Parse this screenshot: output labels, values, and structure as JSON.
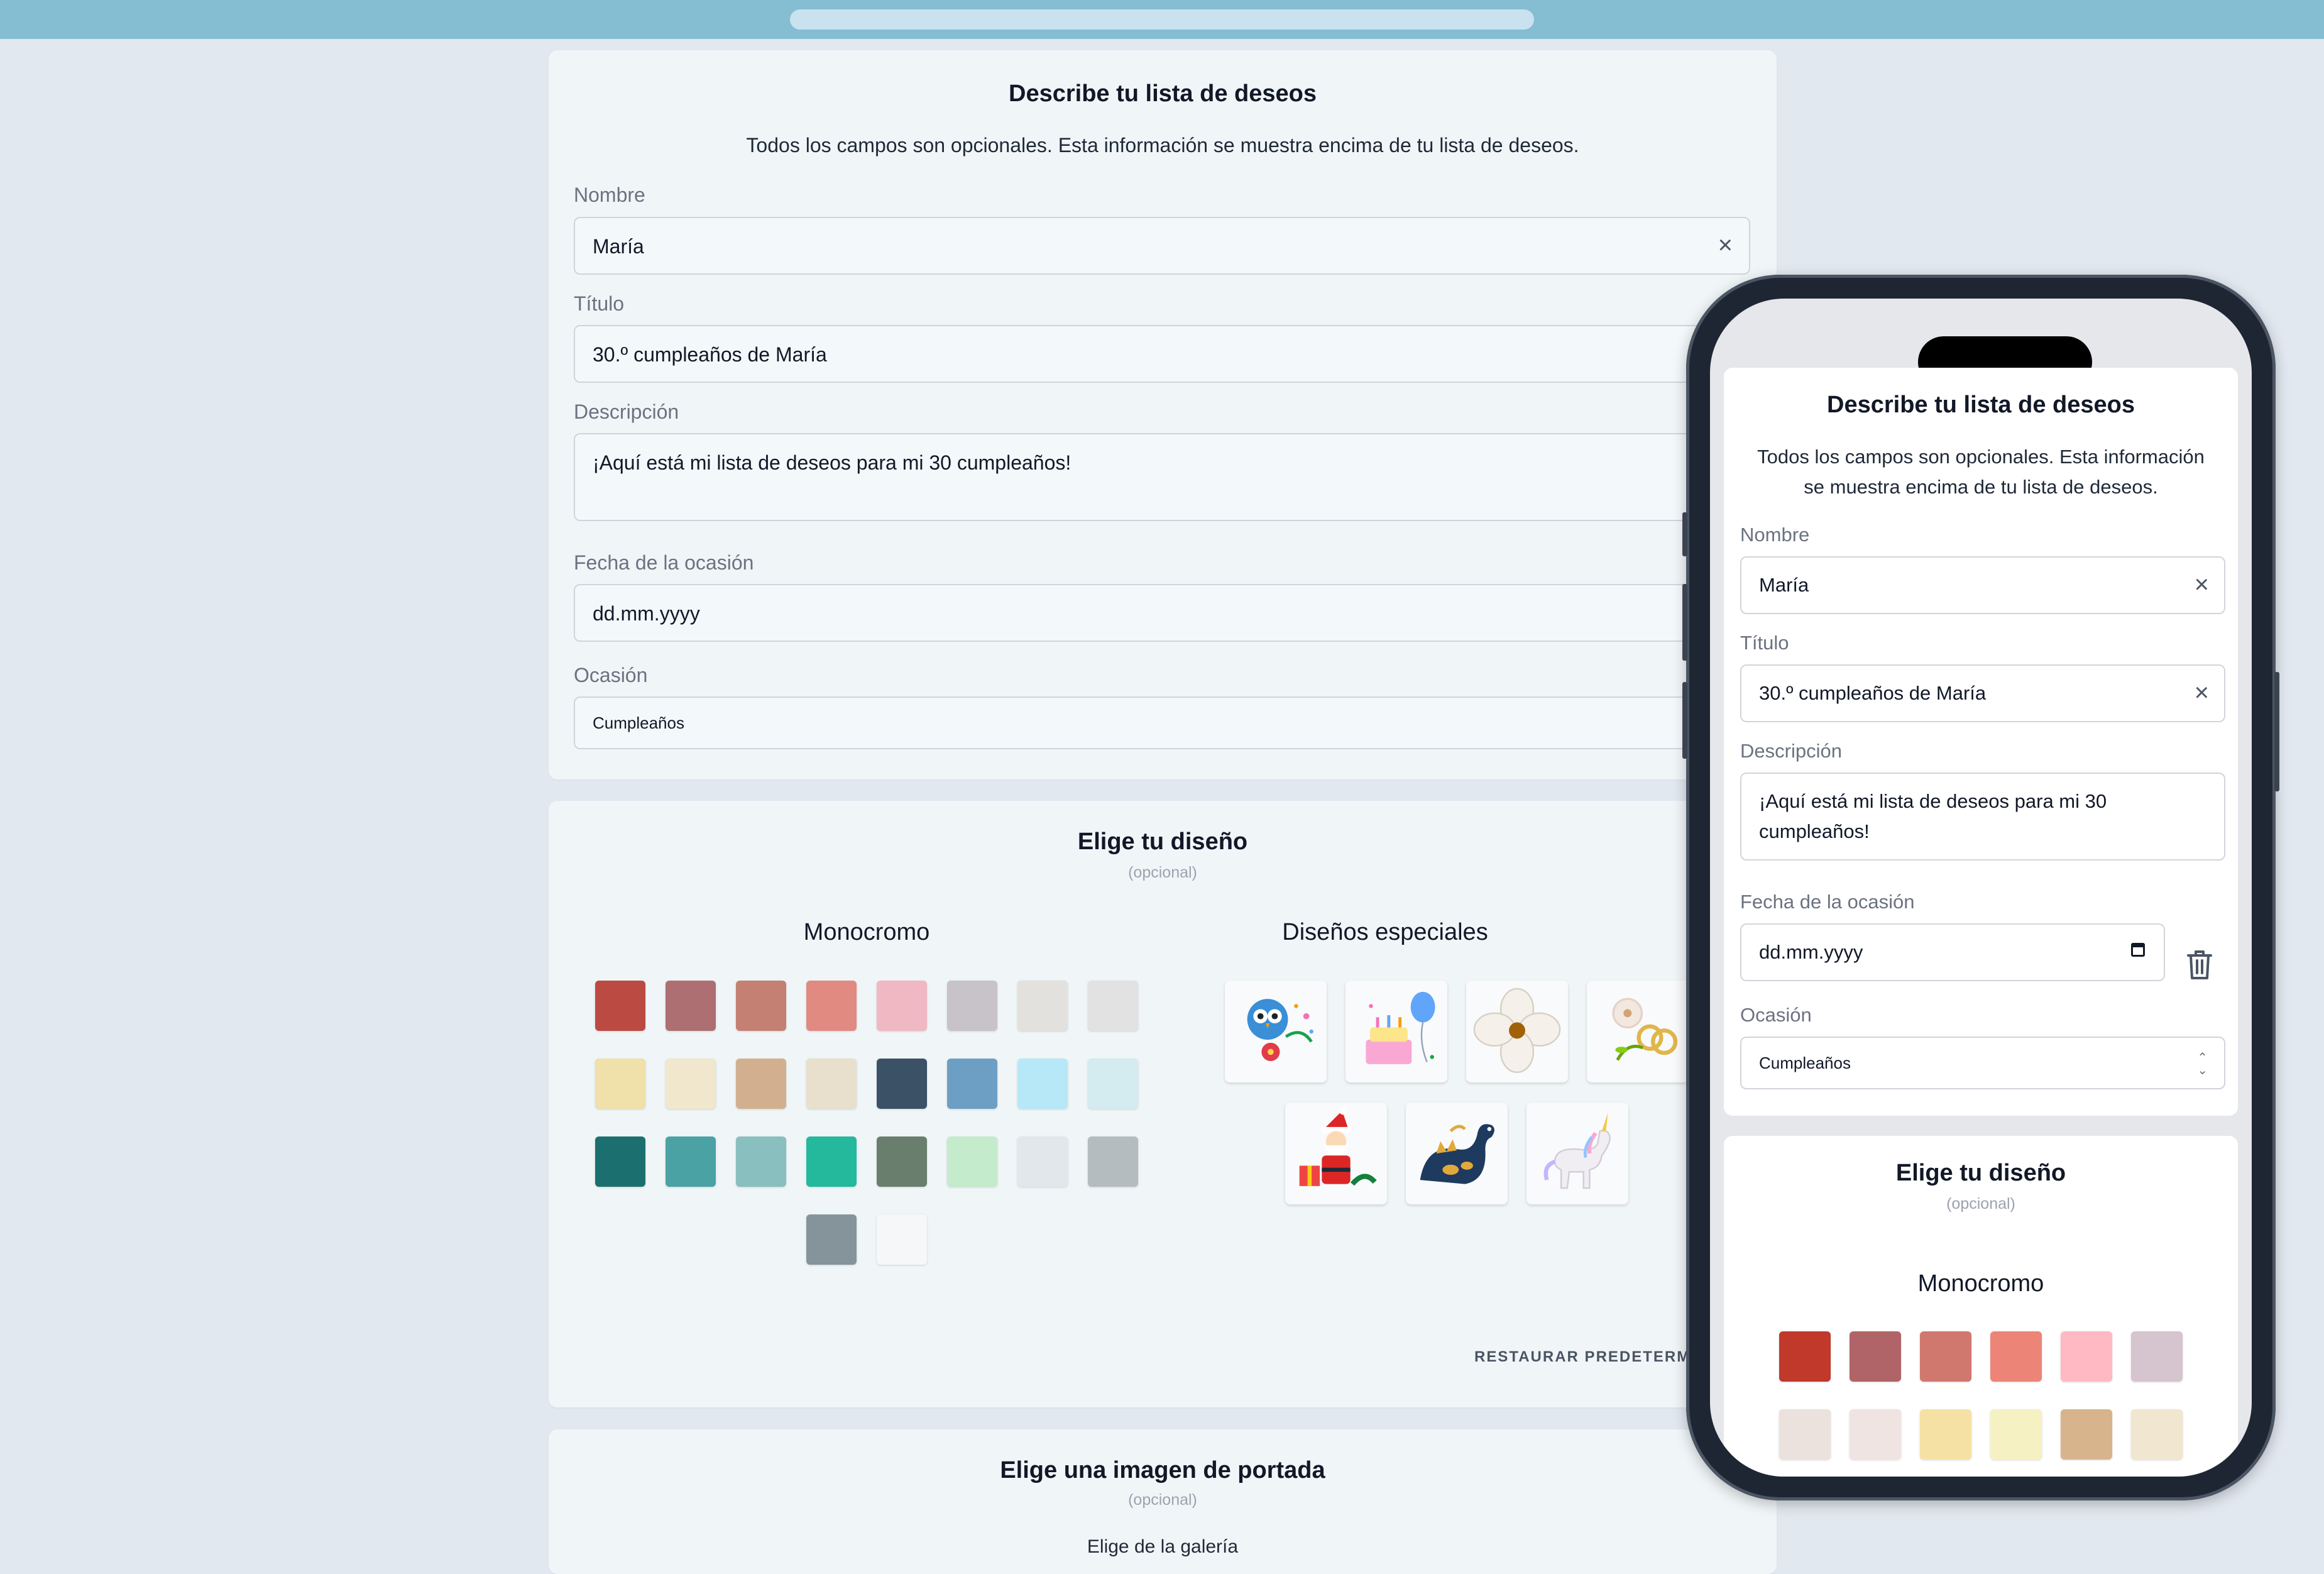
{
  "form": {
    "title": "Describe tu lista de deseos",
    "subtitle": "Todos los campos son opcionales. Esta información se muestra encima de tu lista de deseos.",
    "name_label": "Nombre",
    "name_value": "María",
    "title_label": "Título",
    "title_value": "30.º cumpleaños de María",
    "description_label": "Descripción",
    "description_value": "¡Aquí está mi lista de deseos para mi 30 cumpleaños!",
    "date_label": "Fecha de la ocasión",
    "date_placeholder": "dd.mm.yyyy",
    "occasion_label": "Ocasión",
    "occasion_value": "Cumpleaños",
    "clear_icon": "×"
  },
  "design": {
    "title": "Elige tu diseño",
    "optional": "(opcional)",
    "monochrome_title": "Monocromo",
    "special_title": "Diseños especiales",
    "restore_label": "RESTAURAR PREDETERMIN",
    "colors": [
      "#bb4a42",
      "#ad6f72",
      "#c48073",
      "#e08a82",
      "#f0b8c3",
      "#c8c3c9",
      "#e2e1dd",
      "#e2e2e2",
      "#f0e0a9",
      "#f0e7cc",
      "#d2b08f",
      "#e8e0cd",
      "#3b5166",
      "#6d9fc4",
      "#b7e8f7",
      "#d4ebf0",
      "#1b706f",
      "#4aa2a5",
      "#89bfbe",
      "#24b89c",
      "#6a7e6d",
      "#c4ebcb",
      "#e2e7ec",
      "#b5bcc0",
      "#84949a",
      "#f5f7f8"
    ],
    "special_designs": [
      "owl-flowers",
      "birthday-cake",
      "white-flower",
      "rings-flowers",
      "santa-claus",
      "dinosaur",
      "unicorn"
    ]
  },
  "cover": {
    "title": "Elige una imagen de portada",
    "optional": "(opcional)",
    "gallery_label": "Elige de la galería"
  },
  "phone": {
    "colors": [
      "#c0392b",
      "#b06467",
      "#d0786e",
      "#ec8577",
      "#ffb9c3",
      "#d6c4ce",
      "#ebe2de",
      "#efe4e2",
      "#f5e1a3",
      "#f6f1c2",
      "#d8b48c",
      "#f1e6cf"
    ]
  }
}
